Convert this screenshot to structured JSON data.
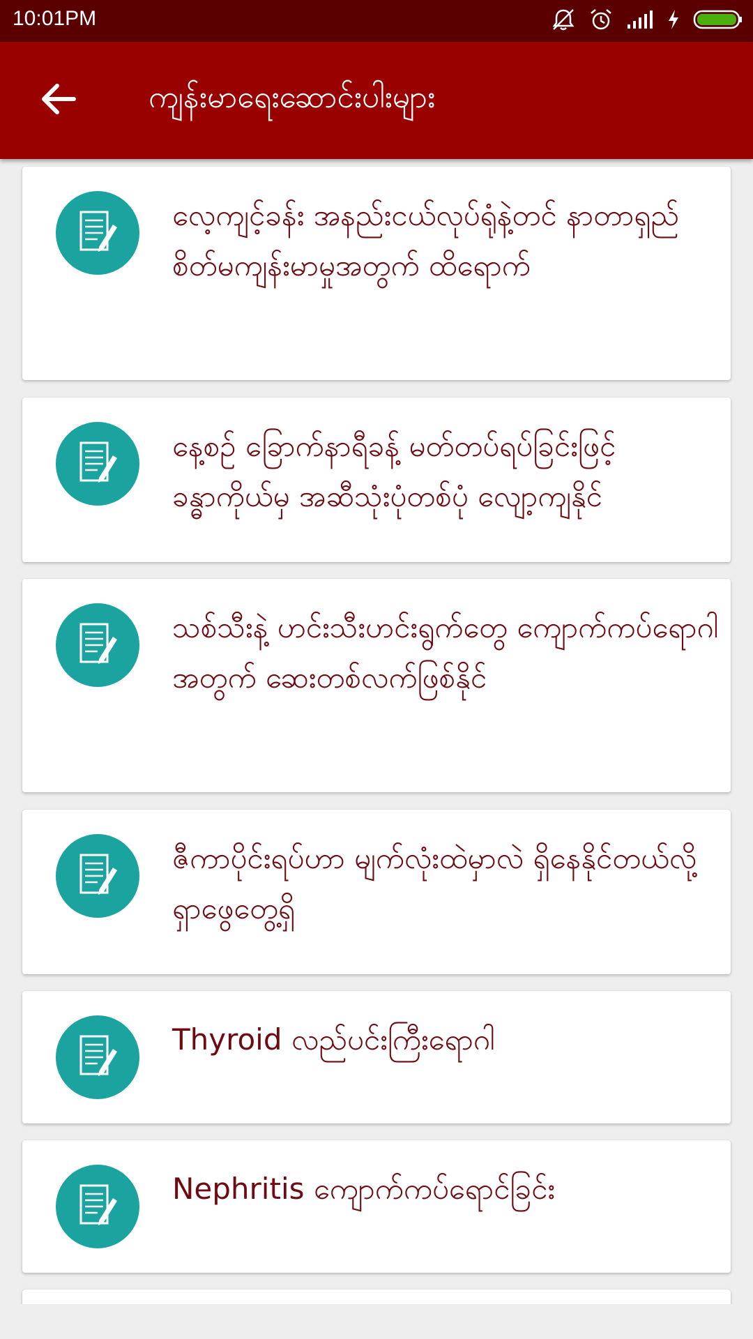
{
  "status_bar": {
    "time": "10:01PM",
    "icons": [
      "mute-icon",
      "alarm-icon",
      "signal-icon",
      "charging-icon",
      "battery-icon"
    ]
  },
  "app_bar": {
    "title": "ကျန်းမာရေးဆောင်းပါးများ",
    "back_icon": "arrow-back-icon"
  },
  "articles": [
    {
      "title": "လေ့ကျင့်ခန်း အနည်းငယ်လုပ်ရုံနဲ့တင် နာတာရှည် စိတ်မကျန်းမာမှုအတွက် ထိရောက်",
      "icon": "document-edit-icon"
    },
    {
      "title": "နေ့စဉ် ခြောက်နာရီခန့် မတ်တပ်ရပ်ခြင်းဖြင့် ခန္ဓာကိုယ်မှ အဆီသုံးပုံတစ်ပုံ လျော့ကျနိုင်",
      "icon": "document-edit-icon"
    },
    {
      "title": "သစ်သီးနဲ့ ဟင်းသီးဟင်းရွက်တွေ ကျောက်ကပ်ရောဂါအတွက် ဆေးတစ်လက်ဖြစ်နိုင်",
      "icon": "document-edit-icon"
    },
    {
      "title": "ဇီကာပိုင်းရပ်ဟာ မျက်လုံးထဲမှာလဲ ရှိနေနိုင်တယ်လို့ ရှာဖွေတွေ့ရှိ",
      "icon": "document-edit-icon"
    },
    {
      "title": "Thyroid လည်ပင်းကြီးရောဂါ",
      "icon": "document-edit-icon"
    },
    {
      "title": "Nephritis ကျောက်ကပ်ရောင်ခြင်း",
      "icon": "document-edit-icon"
    }
  ],
  "colors": {
    "status_bar": "#5a0000",
    "app_bar": "#990000",
    "icon_circle": "#1aa39f",
    "text": "#6e0b12",
    "battery": "#4caf10"
  }
}
